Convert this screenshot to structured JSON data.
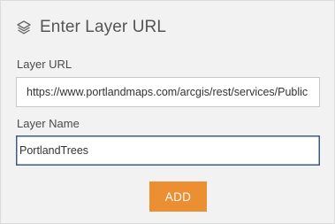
{
  "header": {
    "icon": "layers-icon",
    "title": "Enter Layer URL"
  },
  "layer_url": {
    "label": "Layer URL",
    "value": "https://www.portlandmaps.com/arcgis/rest/services/Public"
  },
  "layer_name": {
    "label": "Layer Name",
    "value": "PortlandTrees"
  },
  "actions": {
    "add_label": "ADD"
  },
  "colors": {
    "panel_background": "#f2f2f2",
    "button_background": "#ec8e32",
    "button_text": "#ffffff",
    "focused_border": "#3d5a80"
  }
}
